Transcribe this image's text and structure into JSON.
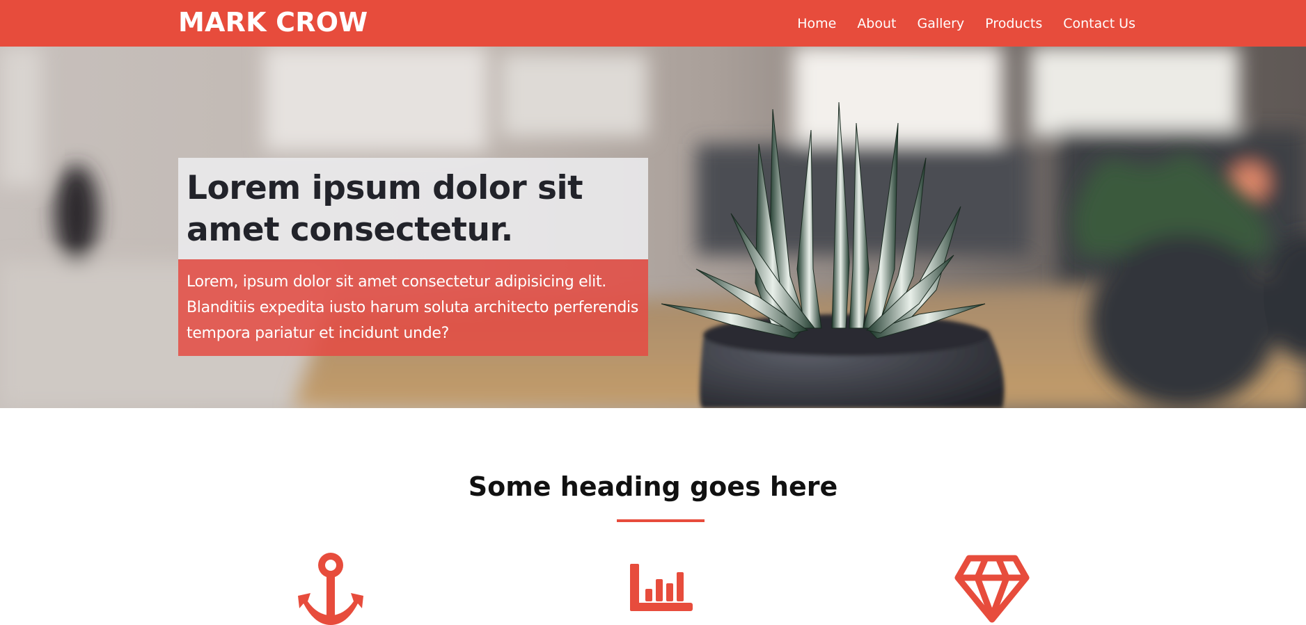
{
  "brand": "MARK CROW",
  "nav": {
    "items": [
      {
        "label": "Home"
      },
      {
        "label": "About"
      },
      {
        "label": "Gallery"
      },
      {
        "label": "Products"
      },
      {
        "label": "Contact Us"
      }
    ]
  },
  "hero": {
    "title": "Lorem ipsum dolor sit amet consectetur.",
    "text": "Lorem, ipsum dolor sit amet consectetur adipisicing elit. Blanditiis expedita iusto harum soluta architecto perferendis tempora pariatur et incidunt unde?"
  },
  "features": {
    "heading": "Some heading goes here",
    "icons": [
      "anchor-icon",
      "bar-chart-icon",
      "diamond-icon"
    ]
  },
  "colors": {
    "accent": "#e74c3c",
    "title_text": "#22232a",
    "white": "#ffffff"
  }
}
